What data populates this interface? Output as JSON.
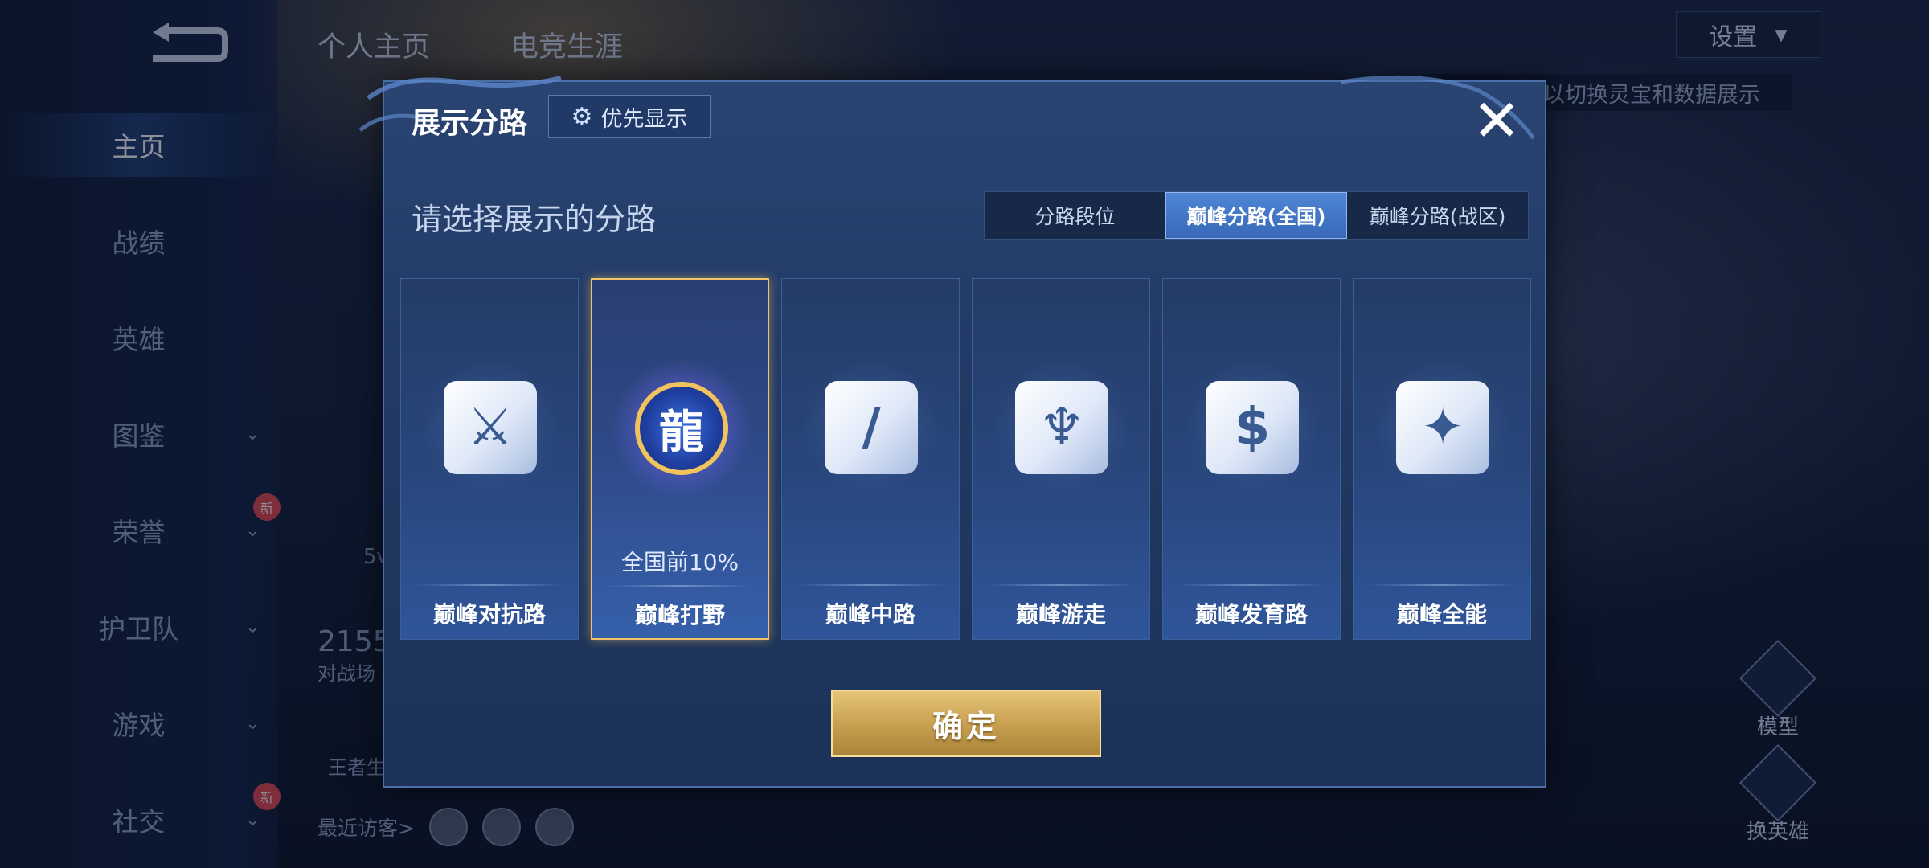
{
  "sidebar": {
    "items": [
      {
        "label": "主页",
        "active": true,
        "has_chevron": false,
        "new": false
      },
      {
        "label": "战绩",
        "active": false,
        "has_chevron": false,
        "new": false
      },
      {
        "label": "英雄",
        "active": false,
        "has_chevron": false,
        "new": false
      },
      {
        "label": "图鉴",
        "active": false,
        "has_chevron": true,
        "new": false
      },
      {
        "label": "荣誉",
        "active": false,
        "has_chevron": true,
        "new": true
      },
      {
        "label": "护卫队",
        "active": false,
        "has_chevron": true,
        "new": false
      },
      {
        "label": "游戏",
        "active": false,
        "has_chevron": true,
        "new": false
      },
      {
        "label": "社交",
        "active": false,
        "has_chevron": true,
        "new": true
      }
    ],
    "new_badge": "新"
  },
  "top_tabs": [
    "个人主页",
    "电竞生涯"
  ],
  "settings": {
    "label": "设置"
  },
  "tip_bar": {
    "text": "以切换灵宝和数据展示"
  },
  "side_buttons": [
    {
      "label": "模型"
    },
    {
      "label": "换英雄"
    }
  ],
  "background_text": {
    "number": "2155",
    "battle": "对战场",
    "king": "王者生",
    "five": "5v"
  },
  "visitors": {
    "label": "最近访客>"
  },
  "modal": {
    "title": "展示分路",
    "priority_button": "优先显示",
    "close_icon": "close-icon",
    "prompt": "请选择展示的分路",
    "segments": [
      {
        "label": "分路段位",
        "active": false
      },
      {
        "label": "巅峰分路(全国)",
        "active": true
      },
      {
        "label": "巅峰分路(战区)",
        "active": false
      }
    ],
    "cards": [
      {
        "label": "巅峰对抗路",
        "rank": "",
        "selected": false,
        "icon": "sword-icon",
        "glyph": "⚔"
      },
      {
        "label": "巅峰打野",
        "rank": "全国前10%",
        "selected": true,
        "icon": "dragon-emblem-icon",
        "glyph": "龍"
      },
      {
        "label": "巅峰中路",
        "rank": "",
        "selected": false,
        "icon": "staff-icon",
        "glyph": "∕"
      },
      {
        "label": "巅峰游走",
        "rank": "",
        "selected": false,
        "icon": "wings-icon",
        "glyph": "♆"
      },
      {
        "label": "巅峰发育路",
        "rank": "",
        "selected": false,
        "icon": "bow-icon",
        "glyph": "$"
      },
      {
        "label": "巅峰全能",
        "rank": "",
        "selected": false,
        "icon": "diamond-icon",
        "glyph": "✦"
      }
    ],
    "confirm": "确定"
  },
  "colors": {
    "accent_gold": "#f1c46c",
    "active_blue": "#4f86d6",
    "modal_bg": "#223a65"
  }
}
